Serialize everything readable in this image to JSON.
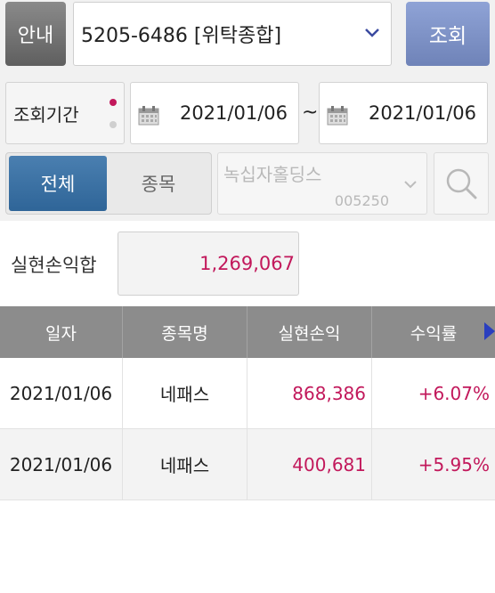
{
  "header": {
    "info_button": "안내",
    "account": "5205-6486 [위탁종합]",
    "query_button": "조회"
  },
  "period": {
    "label": "조회기간",
    "start_date": "2021/01/06",
    "separator": "~",
    "end_date": "2021/01/06"
  },
  "filter": {
    "all_tab": "전체",
    "stock_tab": "종목",
    "stock_name": "녹십자홀딩스",
    "stock_code": "005250"
  },
  "summary": {
    "label": "실현손익합",
    "value": "1,269,067"
  },
  "table": {
    "headers": [
      "일자",
      "종목명",
      "실현손익",
      "수익률"
    ],
    "rows": [
      {
        "date": "2021/01/06",
        "name": "네패스",
        "pnl": "868,386",
        "rate": "+6.07%"
      },
      {
        "date": "2021/01/06",
        "name": "네패스",
        "pnl": "400,681",
        "rate": "+5.95%"
      }
    ]
  },
  "colors": {
    "accent_blue": "#2f6598",
    "query_blue": "#7b8fc6",
    "profit_pink": "#c2185b"
  },
  "icons": {
    "dropdown": "chevron-down-icon",
    "calendar": "calendar-icon",
    "search": "search-icon",
    "scroll_right": "triangle-right-icon"
  }
}
